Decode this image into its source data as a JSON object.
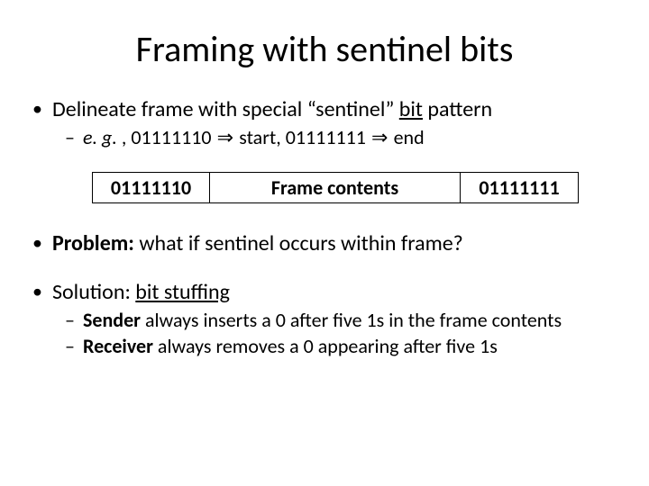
{
  "title": "Framing with sentinel bits",
  "bullet1": {
    "text_pre": "Delineate frame with special “sentinel” ",
    "text_bit": "bit",
    "text_post": " pattern",
    "sub": {
      "eg": "e. g. ",
      "start_bits": "01111110",
      "arrow": " ⇒ ",
      "start_label": "start, ",
      "end_bits": "01111111",
      "end_label": "end"
    }
  },
  "frame": {
    "start": "01111110",
    "mid": "Frame contents",
    "end": "01111111"
  },
  "bullet2": {
    "problem_label": "Problem:",
    "problem_text": " what if sentinel occurs within frame?"
  },
  "bullet3": {
    "solution_pre": "Solution: ",
    "solution_term": "bit stuffing",
    "subs": {
      "sender_label": "Sender",
      "sender_text": " always inserts a 0 after five 1s in the frame contents",
      "receiver_label": "Receiver",
      "receiver_text": " always removes a 0 appearing after five 1s"
    }
  }
}
